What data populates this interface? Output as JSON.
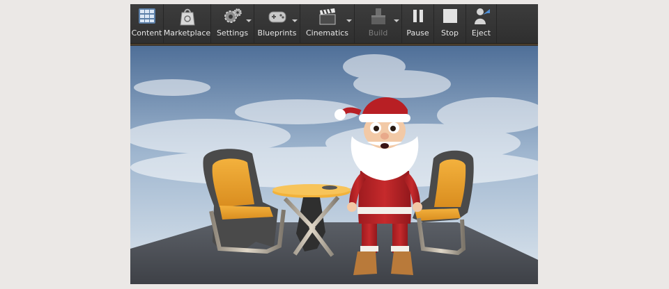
{
  "toolbar": {
    "content_label": "Content",
    "marketplace_label": "Marketplace",
    "settings_label": "Settings",
    "blueprints_label": "Blueprints",
    "cinematics_label": "Cinematics",
    "build_label": "Build",
    "pause_label": "Pause",
    "stop_label": "Stop",
    "eject_label": "Eject"
  },
  "icons": {
    "content": "content-browser-icon",
    "marketplace": "marketplace-bag-icon",
    "settings": "settings-gears-icon",
    "blueprints": "blueprint-gamepad-icon",
    "cinematics": "clapperboard-icon",
    "build": "build-blocks-icon",
    "pause": "pause-icon",
    "stop": "stop-icon",
    "eject": "eject-icon"
  },
  "colors": {
    "toolbar_bg": "#333333",
    "label_text": "#e6e6e6",
    "disabled_text": "#7c7c7c"
  }
}
